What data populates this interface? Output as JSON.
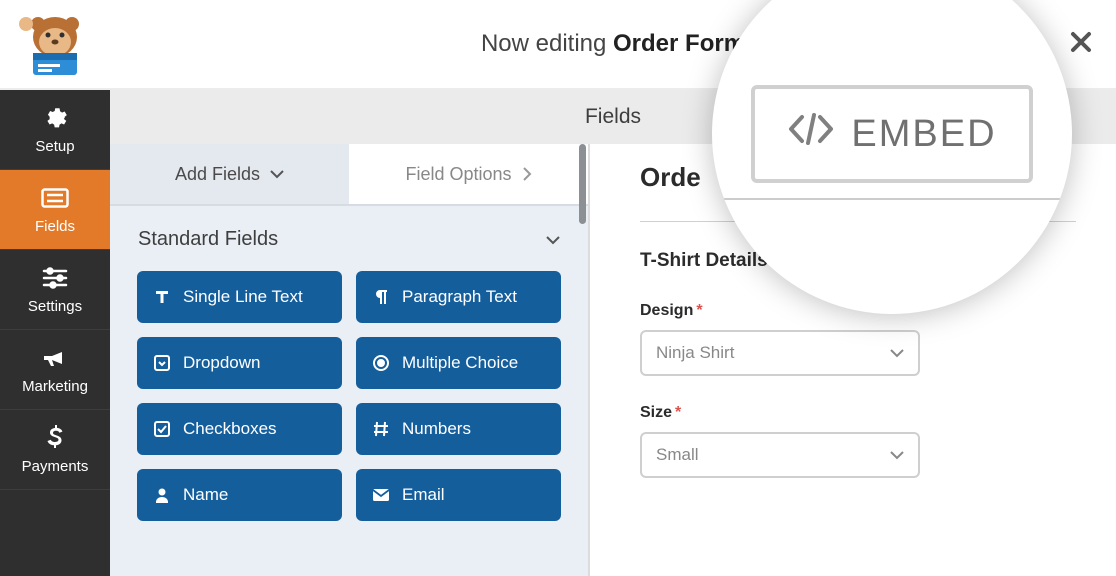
{
  "header": {
    "editing_prefix": "Now editing ",
    "form_name": "Order Form"
  },
  "tabs": {
    "fields_label": "Fields"
  },
  "sidebar": [
    {
      "id": "setup",
      "label": "Setup",
      "icon": "gear-icon"
    },
    {
      "id": "fields",
      "label": "Fields",
      "icon": "list-icon"
    },
    {
      "id": "settings",
      "label": "Settings",
      "icon": "sliders-icon"
    },
    {
      "id": "marketing",
      "label": "Marketing",
      "icon": "bullhorn-icon"
    },
    {
      "id": "payments",
      "label": "Payments",
      "icon": "dollar-icon"
    }
  ],
  "pane_tabs": {
    "add_fields": "Add Fields",
    "field_options": "Field Options"
  },
  "section_header": "Standard Fields",
  "fields": [
    {
      "label": "Single Line Text",
      "icon": "text-cursor-icon"
    },
    {
      "label": "Paragraph Text",
      "icon": "paragraph-icon"
    },
    {
      "label": "Dropdown",
      "icon": "caret-down-square-icon"
    },
    {
      "label": "Multiple Choice",
      "icon": "radio-dot-icon"
    },
    {
      "label": "Checkboxes",
      "icon": "check-square-icon"
    },
    {
      "label": "Numbers",
      "icon": "hash-icon"
    },
    {
      "label": "Name",
      "icon": "person-icon"
    },
    {
      "label": "Email",
      "icon": "envelope-icon"
    }
  ],
  "preview": {
    "form_title_partial": "Orde",
    "section": "T-Shirt Details",
    "design": {
      "label": "Design",
      "value": "Ninja Shirt"
    },
    "size": {
      "label": "Size",
      "value": "Small"
    }
  },
  "embed": {
    "label": "EMBED"
  }
}
